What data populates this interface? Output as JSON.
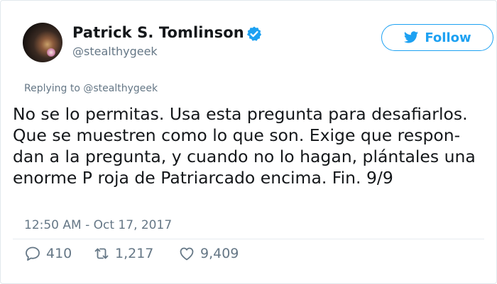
{
  "author": {
    "display_name": "Patrick S. Tomlinson",
    "handle": "@stealthygeek",
    "verified": true
  },
  "follow_button": {
    "label": "Follow",
    "icon": "twitter-bird-icon"
  },
  "reply_context": "Replying to @stealthygeek",
  "tweet": {
    "lines": [
      "No se lo permitas. Usa esta pregunta para desafiarlos.",
      "Que se muestren como lo que son. Exige que respon-",
      "dan a la pregunta, y cuando no lo hagan, plántales una",
      "enorme P roja de Patriarcado encima. Fin. 9/9"
    ]
  },
  "timestamp": "12:50 AM - Oct 17, 2017",
  "actions": {
    "replies": "410",
    "retweets": "1,217",
    "likes": "9,409"
  },
  "colors": {
    "accent": "#1da1f2",
    "text": "#14171a",
    "muted": "#657786",
    "border": "#e1e8ed"
  }
}
